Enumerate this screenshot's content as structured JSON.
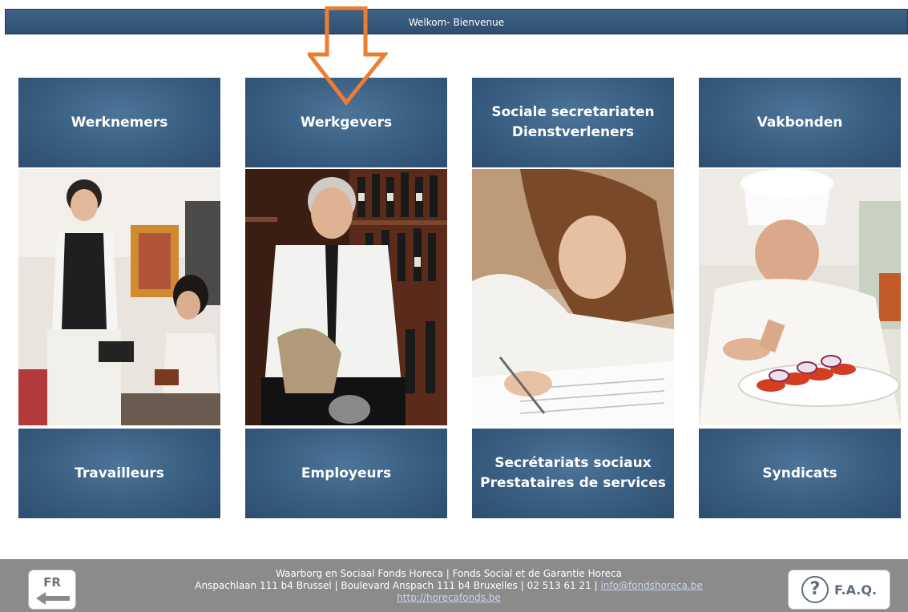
{
  "header": {
    "title": "Welkom- Bienvenue"
  },
  "columns": [
    {
      "top_label": "Werknemers",
      "bottom_label": "Travailleurs",
      "photo": "waiter-serving-guest-photo"
    },
    {
      "top_label": "Werkgevers",
      "bottom_label": "Employeurs",
      "photo": "restaurant-owner-photo"
    },
    {
      "top_label": "Sociale secretariaten\nDienstverleners",
      "bottom_label": "Secrétariats sociaux\nPrestataires de services",
      "photo": "woman-signing-document-photo"
    },
    {
      "top_label": "Vakbonden",
      "bottom_label": "Syndicats",
      "photo": "chef-plating-dish-photo"
    }
  ],
  "footer": {
    "line1": "Waarborg en Sociaal Fonds Horeca | Fonds Social et de Garantie Horeca",
    "line2": "Anspachlaan 111 b4 Brussel | Boulevard Anspach 111 b4 Bruxelles | 02 513 61 21 | ",
    "email": "info@fondshoreca.be",
    "website": "http://horecafonds.be"
  },
  "buttons": {
    "language": "FR",
    "faq": "F.A.Q.",
    "faq_symbol": "?"
  },
  "colors": {
    "tile": "#3b6184",
    "header": "#36587b",
    "footer": "#8b8b8b",
    "arrow": "#ed7d31"
  }
}
